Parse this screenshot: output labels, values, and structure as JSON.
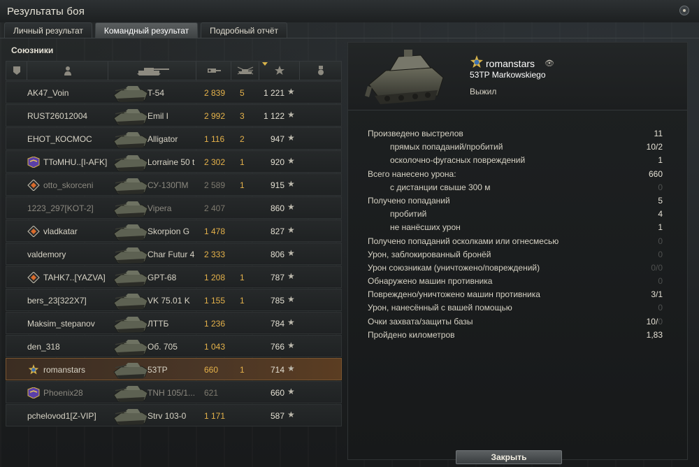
{
  "window": {
    "title": "Результаты боя"
  },
  "tabs": [
    {
      "label": "Личный результат",
      "active": false
    },
    {
      "label": "Командный результат",
      "active": true
    },
    {
      "label": "Подробный отчёт",
      "active": false
    }
  ],
  "team": {
    "label": "Союзники",
    "columns": [
      "squad-icon",
      "player-icon",
      "tank-icon",
      "damage-icon",
      "kills-icon",
      "xp-star-icon",
      "medal-icon"
    ],
    "rows": [
      {
        "name": "AK47_Voin",
        "tank": "T-54",
        "damage": "2 839",
        "kills": "5",
        "xp": "1 221",
        "badge": "",
        "dead": false,
        "self": false
      },
      {
        "name": "RUST26012004",
        "tank": "Emil I",
        "damage": "2 992",
        "kills": "3",
        "xp": "1 122",
        "badge": "",
        "dead": false,
        "self": false
      },
      {
        "name": "ЕНОТ_КОСМОС",
        "tank": "Alligator",
        "damage": "1 116",
        "kills": "2",
        "xp": "947",
        "badge": "",
        "dead": false,
        "self": false
      },
      {
        "name": "TToMHU..[I-AFK]",
        "tank": "Lorraine 50 t",
        "damage": "2 302",
        "kills": "1",
        "xp": "920",
        "badge": "rank-chevron-icon",
        "dead": false,
        "self": false
      },
      {
        "name": "otto_skorceni",
        "tank": "СУ-130ПМ",
        "damage": "2 589",
        "kills": "1",
        "xp": "915",
        "badge": "diamond-badge-icon",
        "dead": true,
        "self": false
      },
      {
        "name": "1223_297[KOT-2]",
        "tank": "Vipera",
        "damage": "2 407",
        "kills": "",
        "xp": "860",
        "badge": "",
        "dead": true,
        "self": false
      },
      {
        "name": "vladkatar",
        "tank": "Skorpion G",
        "damage": "1 478",
        "kills": "",
        "xp": "827",
        "badge": "diamond-badge-icon",
        "dead": false,
        "self": false
      },
      {
        "name": "valdemory",
        "tank": "Char Futur 4",
        "damage": "2 333",
        "kills": "",
        "xp": "806",
        "badge": "",
        "dead": false,
        "self": false
      },
      {
        "name": "TAHK7..[YAZVA]",
        "tank": "GPT-68",
        "damage": "1 208",
        "kills": "1",
        "xp": "787",
        "badge": "diamond-badge-icon",
        "dead": false,
        "self": false
      },
      {
        "name": "bers_23[322X7]",
        "tank": "VK 75.01 K",
        "damage": "1 155",
        "kills": "1",
        "xp": "785",
        "badge": "",
        "dead": false,
        "self": false
      },
      {
        "name": "Maksim_stepanov",
        "tank": "ЛТТБ",
        "damage": "1 236",
        "kills": "",
        "xp": "784",
        "badge": "",
        "dead": false,
        "self": false
      },
      {
        "name": "den_318",
        "tank": "Об. 705",
        "damage": "1 043",
        "kills": "",
        "xp": "766",
        "badge": "",
        "dead": false,
        "self": false
      },
      {
        "name": "romanstars",
        "tank": "53TP",
        "damage": "660",
        "kills": "1",
        "xp": "714",
        "badge": "star-emblem-icon",
        "dead": false,
        "self": true
      },
      {
        "name": "Phoenix28",
        "tank": "TNH 105/1...",
        "damage": "621",
        "kills": "",
        "xp": "660",
        "badge": "rank-chevron-icon",
        "dead": true,
        "self": false
      },
      {
        "name": "pchelovod1[Z-VIP]",
        "tank": "Strv 103-0",
        "damage": "1 171",
        "kills": "",
        "xp": "587",
        "badge": "",
        "dead": false,
        "self": false
      }
    ]
  },
  "detail": {
    "player": "romanstars",
    "vehicle": "53TP Markowskiego",
    "status": "Выжил",
    "stats": [
      {
        "label": "Произведено выстрелов",
        "value": "11",
        "sub": false,
        "zero": false
      },
      {
        "label": "прямых попаданий/пробитий",
        "value": "10/2",
        "sub": true,
        "zero": false
      },
      {
        "label": "осколочно-фугасных повреждений",
        "value": "1",
        "sub": true,
        "zero": false
      },
      {
        "label": "Всего нанесено урона:",
        "value": "660",
        "sub": false,
        "zero": false
      },
      {
        "label": "с дистанции свыше 300 м",
        "value": "0",
        "sub": true,
        "zero": true
      },
      {
        "label": "Получено попаданий",
        "value": "5",
        "sub": false,
        "zero": false
      },
      {
        "label": "пробитий",
        "value": "4",
        "sub": true,
        "zero": false
      },
      {
        "label": "не нанёсших урон",
        "value": "1",
        "sub": true,
        "zero": false
      },
      {
        "label": "Получено попаданий осколками или огнесмесью",
        "value": "0",
        "sub": false,
        "zero": true
      },
      {
        "label": "Урон, заблокированный бронёй",
        "value": "0",
        "sub": false,
        "zero": true
      },
      {
        "label": "Урон союзникам (уничтожено/повреждений)",
        "value": "0/0",
        "sub": false,
        "zero": true
      },
      {
        "label": "Обнаружено машин противника",
        "value": "0",
        "sub": false,
        "zero": true
      },
      {
        "label": "Повреждено/уничтожено машин противника",
        "value": "3/1",
        "sub": false,
        "zero": false
      },
      {
        "label": "Урон, нанесённый с вашей помощью",
        "value": "0",
        "sub": false,
        "zero": true
      },
      {
        "label": "Очки захвата/защиты базы",
        "value_main": "10/",
        "value_dim": "0",
        "sub": false,
        "zero": false
      },
      {
        "label": "Пройдено километров",
        "value": "1,83",
        "sub": false,
        "zero": false
      }
    ]
  },
  "footer": {
    "close_label": "Закрыть"
  },
  "colors": {
    "accent_damage": "#e5b24a",
    "self_row": "#4a3626",
    "dim_value": "#4e504f"
  }
}
